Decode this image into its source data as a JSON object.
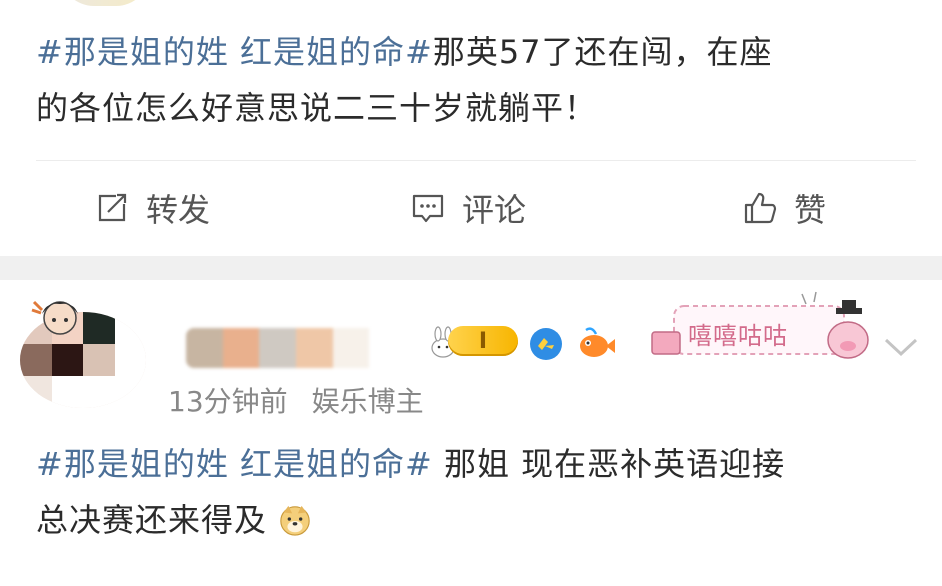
{
  "post1": {
    "topic_tag": "#那是姐的姓 红是姐的命#",
    "body_line1": "那英57了还在闯，在座",
    "body_line2": "的各位怎么好意思说二三十岁就躺平！"
  },
  "actions": {
    "repost_label": "转发",
    "comment_label": "评论",
    "like_label": "赞"
  },
  "post2": {
    "user_level": "I",
    "time": "13分钟前",
    "user_category": "娱乐博主",
    "sticker_text": "嘻嘻咕咕",
    "topic_tag": "#那是姐的姓 红是姐的命#",
    "body_line1": " 那姐 现在恶补英语迎接",
    "body_line2": "总决赛还来得及",
    "emoji": "doge-emoji"
  },
  "colors": {
    "tag": "#4b6f97",
    "text": "#2b2b2b",
    "meta": "#888888",
    "separator_band": "#f0f0f0"
  },
  "icons": [
    "repost-icon",
    "comment-icon",
    "like-icon",
    "rabbit-badge-icon",
    "vip-badge-icon",
    "fish-badge-icon",
    "chevron-down-icon",
    "doge-emoji"
  ]
}
